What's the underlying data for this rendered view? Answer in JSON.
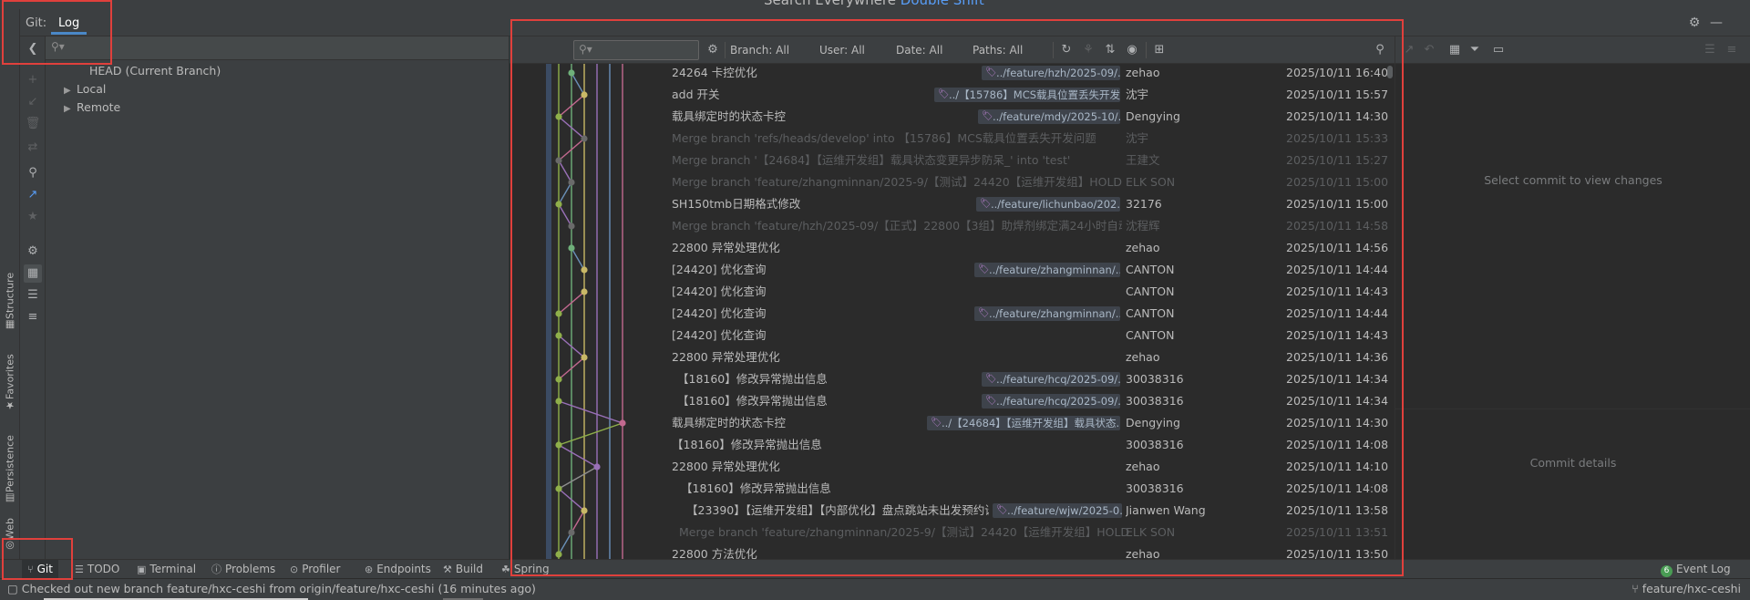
{
  "search_hint": {
    "text": "Search Everywhere",
    "shortcut": "Double Shift"
  },
  "git_window": {
    "title": "Git:",
    "tab": "Log"
  },
  "side_tabs": [
    "Structure",
    "Favorites",
    "Persistence",
    "Web"
  ],
  "branches": {
    "head": "HEAD (Current Branch)",
    "local": "Local",
    "remote": "Remote"
  },
  "log_toolbar": {
    "branch": "Branch: All",
    "user": "User: All",
    "date": "Date: All",
    "paths": "Paths: All"
  },
  "commits": [
    {
      "subject": "24264 卡控优化",
      "ref": "../feature/hzh/2025-09/...",
      "author": "zehao",
      "date": "2025/10/11 16:40",
      "dim": false
    },
    {
      "subject": "add 开关",
      "ref": "../【15786】MCS载具位置丢失开发...",
      "author": "沈宇",
      "date": "2025/10/11 15:57",
      "dim": false
    },
    {
      "subject": "载具绑定时的状态卡控",
      "ref": "../feature/mdy/2025-10/...",
      "author": "Dengying",
      "date": "2025/10/11 14:30",
      "dim": false
    },
    {
      "subject": "Merge branch 'refs/heads/develop' into 【15786】MCS载具位置丢失开发问题",
      "ref": "",
      "author": "沈宇",
      "date": "2025/10/11 15:33",
      "dim": true
    },
    {
      "subject": "Merge branch '【24684】【运维开发组】载具状态变更异步防呆_' into 'test'",
      "ref": "",
      "author": "王建文",
      "date": "2025/10/11 15:27",
      "dim": true
    },
    {
      "subject": "Merge branch 'feature/zhangminnan/2025-9/【测试】24420【运维开发组】HOLD处理时",
      "ref": "",
      "author": "ELK SON",
      "date": "2025/10/11 15:00",
      "dim": true
    },
    {
      "subject": "SH150tmb日期格式修改",
      "ref": "../feature/lichunbao/202...",
      "author": "32176",
      "date": "2025/10/11 15:00",
      "dim": false
    },
    {
      "subject": "Merge branch 'feature/hzh/2025-09/【正式】22800【3组】助焊剂绑定满24小时自动下机",
      "ref": "",
      "author": "沈程辉",
      "date": "2025/10/11 14:58",
      "dim": true
    },
    {
      "subject": "22800 异常处理优化",
      "ref": "",
      "author": "zehao",
      "date": "2025/10/11 14:56",
      "dim": false
    },
    {
      "subject": "[24420] 优化查询",
      "ref": "../feature/zhangminnan/...",
      "author": "CANTON",
      "date": "2025/10/11 14:44",
      "dim": false
    },
    {
      "subject": "[24420] 优化查询",
      "ref": "",
      "author": "CANTON",
      "date": "2025/10/11 14:43",
      "dim": false
    },
    {
      "subject": "[24420] 优化查询",
      "ref": "../feature/zhangminnan/...",
      "author": "CANTON",
      "date": "2025/10/11 14:44",
      "dim": false
    },
    {
      "subject": "[24420] 优化查询",
      "ref": "",
      "author": "CANTON",
      "date": "2025/10/11 14:43",
      "dim": false
    },
    {
      "subject": "22800 异常处理优化",
      "ref": "",
      "author": "zehao",
      "date": "2025/10/11 14:36",
      "dim": false
    },
    {
      "subject": "【18160】修改异常抛出信息",
      "ref": "../feature/hcq/2025-09/...",
      "author": "30038316",
      "date": "2025/10/11 14:34",
      "dim": false
    },
    {
      "subject": "【18160】修改异常抛出信息",
      "ref": "../feature/hcq/2025-09/...",
      "author": "30038316",
      "date": "2025/10/11 14:34",
      "dim": false
    },
    {
      "subject": "载具绑定时的状态卡控",
      "ref": "../【24684】【运维开发组】载具状态...",
      "author": "Dengying",
      "date": "2025/10/11 14:30",
      "dim": false
    },
    {
      "subject": "【18160】修改异常抛出信息",
      "ref": "",
      "author": "30038316",
      "date": "2025/10/11 14:08",
      "dim": false
    },
    {
      "subject": "22800 异常处理优化",
      "ref": "",
      "author": "zehao",
      "date": "2025/10/11 14:10",
      "dim": false
    },
    {
      "subject": "【18160】修改异常抛出信息",
      "ref": "",
      "author": "30038316",
      "date": "2025/10/11 14:08",
      "dim": false
    },
    {
      "subject": "【23390】【运维开发组】【内部优化】盘点跳站未出发预约设",
      "ref": "../feature/wjw/2025-0...",
      "author": "Jianwen Wang",
      "date": "2025/10/11 13:58",
      "dim": false
    },
    {
      "subject": "Merge branch 'feature/zhangminnan/2025-9/【测试】24420【运维开发组】HOLD处理时",
      "ref": "",
      "author": "ELK SON",
      "date": "2025/10/11 13:51",
      "dim": true
    },
    {
      "subject": "22800 方法优化",
      "ref": "",
      "author": "zehao",
      "date": "2025/10/11 13:50",
      "dim": false
    }
  ],
  "right_panel": {
    "changes_placeholder": "Select commit to view changes",
    "details_placeholder": "Commit details"
  },
  "tool_windows": {
    "git": "Git",
    "todo": "TODO",
    "terminal": "Terminal",
    "problems": "Problems",
    "profiler": "Profiler",
    "endpoints": "Endpoints",
    "build": "Build",
    "spring": "Spring",
    "event_log": "Event Log",
    "event_log_count": "6"
  },
  "status_bar": {
    "message": "Checked out new branch feature/hxc-ceshi from origin/feature/hxc-ceshi (16 minutes ago)",
    "branch": "feature/hxc-ceshi"
  },
  "colors": {
    "highlight": "#e0403c",
    "graph_lanes": [
      "#8faf4a",
      "#6fb07a",
      "#c9b867",
      "#9a70b8",
      "#6a8fb8",
      "#c2698f",
      "#8f8f8f",
      "#75a5a5"
    ]
  }
}
